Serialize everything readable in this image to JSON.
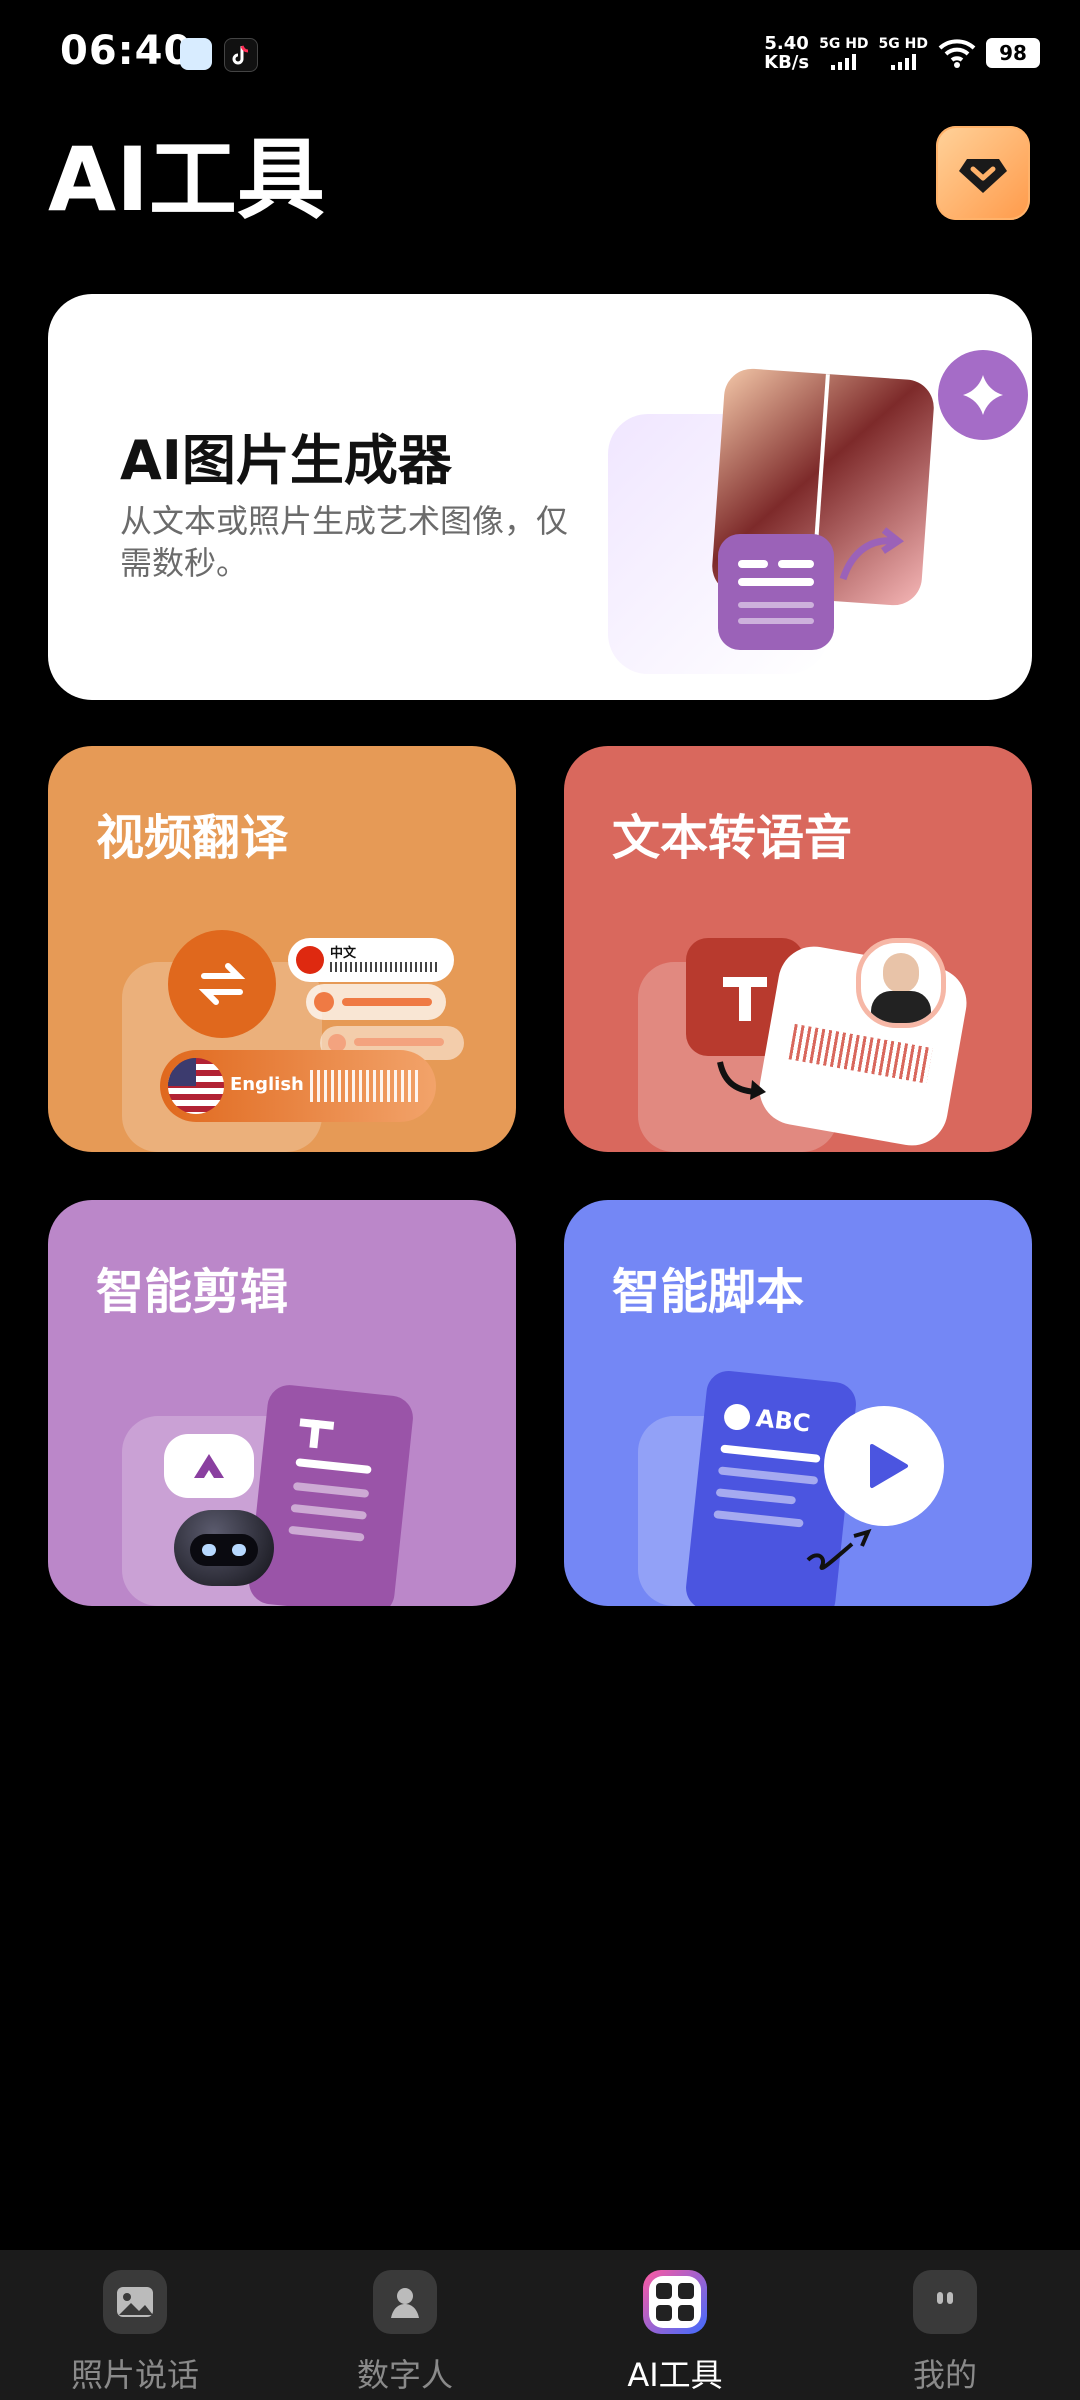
{
  "status_bar": {
    "time": "06:40",
    "speed_value": "5.40",
    "speed_unit": "KB/s",
    "sim1_label": "5G HD",
    "sim2_label": "5G HD",
    "battery": "98"
  },
  "header": {
    "title": "AI工具",
    "vip_icon": "diamond-chevron-icon"
  },
  "features": {
    "image_generator": {
      "title": "AI图片生成器",
      "description": "从文本或照片生成艺术图像，仅需数秒。"
    },
    "video_translate": {
      "title": "视频翻译",
      "lang_from": "中文",
      "lang_to": "English"
    },
    "text_to_speech": {
      "title": "文本转语音"
    },
    "smart_edit": {
      "title": "智能剪辑"
    },
    "smart_script": {
      "title": "智能脚本",
      "doc_label": "ABC"
    }
  },
  "bottom_nav": {
    "items": [
      {
        "label": "照片说话",
        "icon": "photo-icon"
      },
      {
        "label": "数字人",
        "icon": "avatar-icon"
      },
      {
        "label": "AI工具",
        "icon": "grid-icon",
        "active": true
      },
      {
        "label": "我的",
        "icon": "profile-icon"
      }
    ]
  },
  "colors": {
    "image_card": "#ffffff",
    "video_card": "#e69a56",
    "tts_card": "#d9685d",
    "edit_card": "#bb87c9",
    "script_card": "#7487f5"
  }
}
